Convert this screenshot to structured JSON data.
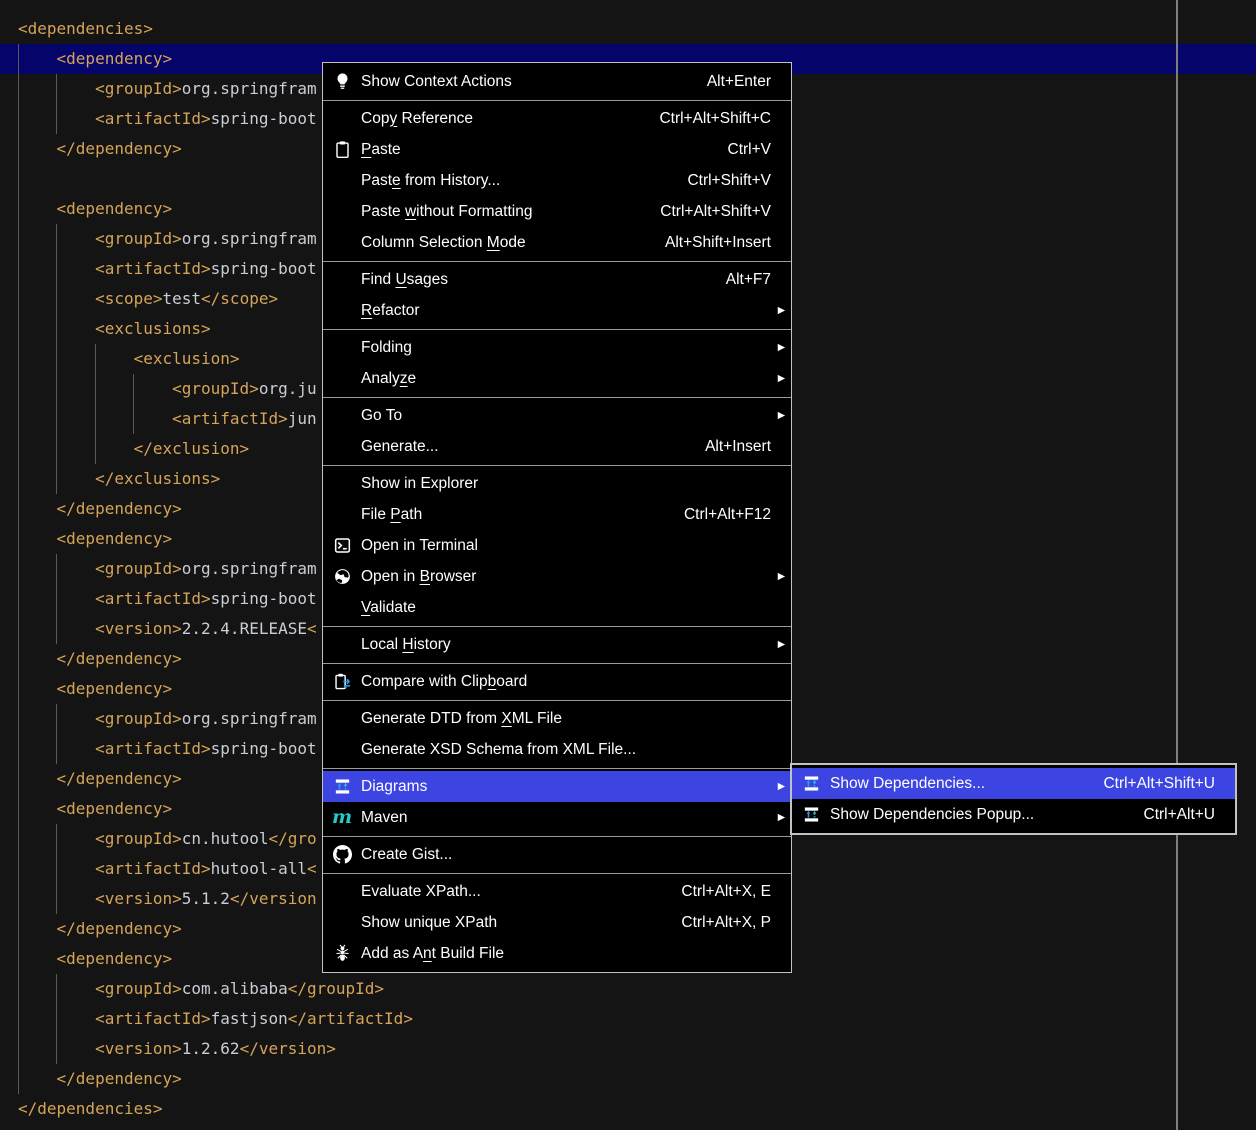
{
  "colors": {
    "editor_background": "#141414",
    "editor_selected_line": "#04046a",
    "xml_tag_color": "#d5a458",
    "xml_text_color": "#c9ced5",
    "menu_highlight": "#3c45e2",
    "maven_cyan": "#25c9c9",
    "diagram_arrow_blue": "#2d9fe8"
  },
  "editor": {
    "selected_line": 2,
    "lines": [
      [
        {
          "c": "tag",
          "s": "<dependencies>"
        }
      ],
      [
        {
          "c": "tag",
          "s": "    <dependency>"
        }
      ],
      [
        {
          "c": "tag",
          "s": "        <groupId>"
        },
        {
          "c": "txt",
          "s": "org.springfram"
        }
      ],
      [
        {
          "c": "tag",
          "s": "        <artifactId>"
        },
        {
          "c": "txt",
          "s": "spring-boot"
        }
      ],
      [
        {
          "c": "tag",
          "s": "    </dependency>"
        }
      ],
      [],
      [
        {
          "c": "tag",
          "s": "    <dependency>"
        }
      ],
      [
        {
          "c": "tag",
          "s": "        <groupId>"
        },
        {
          "c": "txt",
          "s": "org.springfram"
        }
      ],
      [
        {
          "c": "tag",
          "s": "        <artifactId>"
        },
        {
          "c": "txt",
          "s": "spring-boot"
        }
      ],
      [
        {
          "c": "tag",
          "s": "        <scope>"
        },
        {
          "c": "txt",
          "s": "test"
        },
        {
          "c": "tag",
          "s": "</scope>"
        }
      ],
      [
        {
          "c": "tag",
          "s": "        <exclusions>"
        }
      ],
      [
        {
          "c": "tag",
          "s": "            <exclusion>"
        }
      ],
      [
        {
          "c": "tag",
          "s": "                <groupId>"
        },
        {
          "c": "txt",
          "s": "org.ju"
        }
      ],
      [
        {
          "c": "tag",
          "s": "                <artifactId>"
        },
        {
          "c": "txt",
          "s": "jun"
        }
      ],
      [
        {
          "c": "tag",
          "s": "            </exclusion>"
        }
      ],
      [
        {
          "c": "tag",
          "s": "        </exclusions>"
        }
      ],
      [
        {
          "c": "tag",
          "s": "    </dependency>"
        }
      ],
      [
        {
          "c": "tag",
          "s": "    <dependency>"
        }
      ],
      [
        {
          "c": "tag",
          "s": "        <groupId>"
        },
        {
          "c": "txt",
          "s": "org.springfram"
        }
      ],
      [
        {
          "c": "tag",
          "s": "        <artifactId>"
        },
        {
          "c": "txt",
          "s": "spring-boot"
        }
      ],
      [
        {
          "c": "tag",
          "s": "        <version>"
        },
        {
          "c": "txt",
          "s": "2.2.4.RELEASE"
        },
        {
          "c": "tag",
          "s": "<"
        }
      ],
      [
        {
          "c": "tag",
          "s": "    </dependency>"
        }
      ],
      [
        {
          "c": "tag",
          "s": "    <dependency>"
        }
      ],
      [
        {
          "c": "tag",
          "s": "        <groupId>"
        },
        {
          "c": "txt",
          "s": "org.springfram"
        }
      ],
      [
        {
          "c": "tag",
          "s": "        <artifactId>"
        },
        {
          "c": "txt",
          "s": "spring-boot"
        }
      ],
      [
        {
          "c": "tag",
          "s": "    </dependency>"
        }
      ],
      [
        {
          "c": "tag",
          "s": "    <dependency>"
        }
      ],
      [
        {
          "c": "tag",
          "s": "        <groupId>"
        },
        {
          "c": "txt",
          "s": "cn.hutool"
        },
        {
          "c": "tag",
          "s": "</gro"
        }
      ],
      [
        {
          "c": "tag",
          "s": "        <artifactId>"
        },
        {
          "c": "txt",
          "s": "hutool-all"
        },
        {
          "c": "tag",
          "s": "<"
        }
      ],
      [
        {
          "c": "tag",
          "s": "        <version>"
        },
        {
          "c": "txt",
          "s": "5.1.2"
        },
        {
          "c": "tag",
          "s": "</version"
        }
      ],
      [
        {
          "c": "tag",
          "s": "    </dependency>"
        }
      ],
      [
        {
          "c": "tag",
          "s": "    <dependency>"
        }
      ],
      [
        {
          "c": "tag",
          "s": "        <groupId>"
        },
        {
          "c": "txt",
          "s": "com.alibaba"
        },
        {
          "c": "tag",
          "s": "</groupId>"
        }
      ],
      [
        {
          "c": "tag",
          "s": "        <artifactId>"
        },
        {
          "c": "txt",
          "s": "fastjson"
        },
        {
          "c": "tag",
          "s": "</artifactId>"
        }
      ],
      [
        {
          "c": "tag",
          "s": "        <version>"
        },
        {
          "c": "txt",
          "s": "1.2.62"
        },
        {
          "c": "tag",
          "s": "</version>"
        }
      ],
      [
        {
          "c": "tag",
          "s": "    </dependency>"
        }
      ],
      [
        {
          "c": "tag",
          "s": "</dependencies>"
        }
      ]
    ]
  },
  "context_menu": {
    "items": [
      {
        "icon": "lightbulb",
        "label": "Show Context Actions",
        "shortcut": "Alt+Enter",
        "sep_after": true
      },
      {
        "label": "Cop&y Reference",
        "shortcut": "Ctrl+Alt+Shift+C"
      },
      {
        "icon": "clipboard-paste",
        "label": "&Paste",
        "shortcut": "Ctrl+V"
      },
      {
        "label": "Past&e from History...",
        "shortcut": "Ctrl+Shift+V"
      },
      {
        "label": "Paste &without Formatting",
        "shortcut": "Ctrl+Alt+Shift+V"
      },
      {
        "label": "Column Selection &Mode",
        "shortcut": "Alt+Shift+Insert",
        "sep_after": true
      },
      {
        "label": "Find &Usages",
        "shortcut": "Alt+F7"
      },
      {
        "label": "&Refactor",
        "submenu": true,
        "sep_after": true
      },
      {
        "label": "Folding",
        "submenu": true
      },
      {
        "label": "Analy&ze",
        "submenu": true,
        "sep_after": true
      },
      {
        "label": "Go To",
        "submenu": true
      },
      {
        "label": "Generate...",
        "shortcut": "Alt+Insert",
        "sep_after": true
      },
      {
        "label": "Show in Explorer"
      },
      {
        "label": "File &Path",
        "shortcut": "Ctrl+Alt+F12"
      },
      {
        "icon": "terminal",
        "label": "Open in Terminal"
      },
      {
        "icon": "globe",
        "label": "Open in &Browser",
        "submenu": true
      },
      {
        "label": "&Validate",
        "sep_after": true
      },
      {
        "label": "Local &History",
        "submenu": true,
        "sep_after": true
      },
      {
        "icon": "compare-clipboard",
        "label": "Compare with Clip&board",
        "sep_after": true
      },
      {
        "label": "Generate DTD from &XML File"
      },
      {
        "label": "Generate XSD Schema from XML File...",
        "sep_after": true
      },
      {
        "icon": "diagram",
        "label": "Diagrams",
        "submenu": true,
        "highlighted": true
      },
      {
        "icon": "maven",
        "label": "Maven",
        "submenu": true,
        "sep_after": true
      },
      {
        "icon": "github",
        "label": "Create Gist...",
        "sep_after": true
      },
      {
        "label": "Evaluate XPath...",
        "shortcut": "Ctrl+Alt+X, E"
      },
      {
        "label": "Show unique XPath",
        "shortcut": "Ctrl+Alt+X, P"
      },
      {
        "icon": "ant",
        "label": "Add as A&nt Build File"
      }
    ]
  },
  "submenu": {
    "items": [
      {
        "icon": "diagram",
        "label": "Show Dependencies...",
        "shortcut": "Ctrl+Alt+Shift+U",
        "highlighted": true
      },
      {
        "icon": "diagram",
        "label": "Show Dependencies Popup...",
        "shortcut": "Ctrl+Alt+U"
      }
    ]
  }
}
